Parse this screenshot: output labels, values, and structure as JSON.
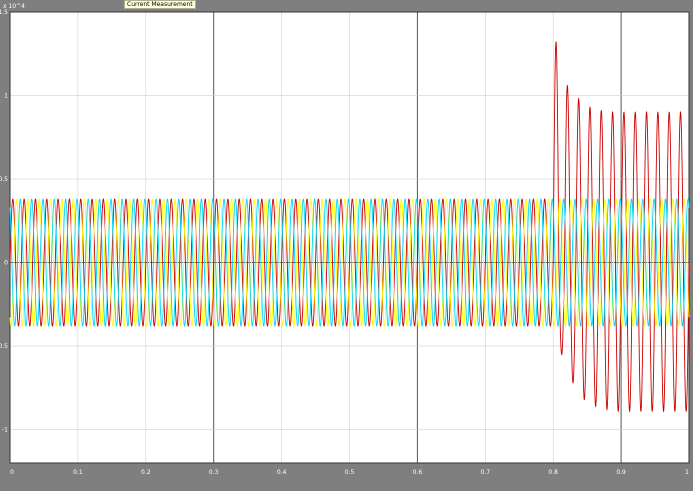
{
  "window": {
    "title": "Current Measurement"
  },
  "chart_data": {
    "type": "line",
    "title": "",
    "xlabel": "",
    "ylabel": "",
    "y_exponent_label": "x 10^4",
    "xlim": [
      0,
      1
    ],
    "ylim": [
      -1.2,
      1.5
    ],
    "x_ticks": [
      "0",
      "0.1",
      "0.2",
      "0.3",
      "0.4",
      "0.5",
      "0.6",
      "0.7",
      "0.8",
      "0.9",
      "1"
    ],
    "y_ticks": [
      "1.5",
      "1",
      "0.5",
      "0",
      "-0.5",
      "-1"
    ],
    "grid": true,
    "frequency_hz": 60,
    "fault_time": 0.8,
    "series": [
      {
        "color": "#cc0000",
        "phase_deg": 0,
        "pre_fault_amplitude": 0.38,
        "post_fault_peaks": [
          1.32,
          1.06,
          0.98,
          0.93,
          0.91,
          0.9
        ],
        "post_fault_troughs": [
          -0.55,
          -0.72,
          -0.82,
          -0.86,
          -0.88,
          -0.89
        ],
        "post_fault_steady_peak": 0.89
      },
      {
        "color": "#ffff00",
        "phase_deg": -120,
        "pre_fault_amplitude": 0.38,
        "post_fault_amplitude": 0.38
      },
      {
        "color": "#00d8ff",
        "phase_deg": 120,
        "pre_fault_amplitude": 0.38,
        "post_fault_amplitude": 0.38
      }
    ]
  }
}
